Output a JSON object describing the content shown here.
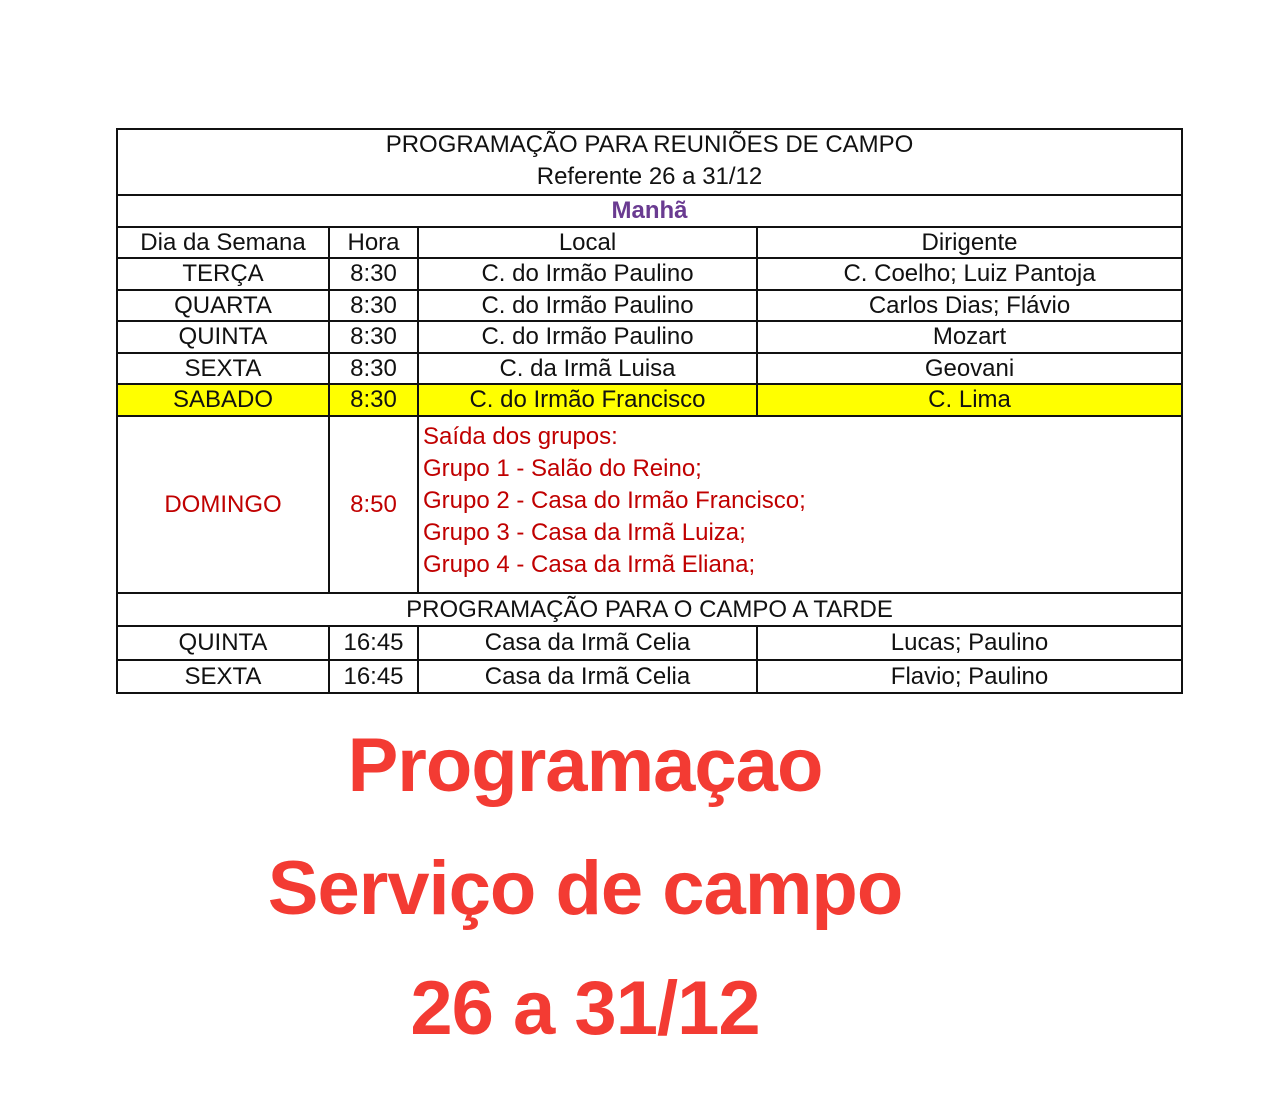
{
  "table": {
    "title_line1": "PROGRAMAÇÃO PARA REUNIÕES DE CAMPO",
    "title_line2": "Referente 26 a 31/12",
    "section_morning": "Manhã",
    "headers": {
      "day": "Dia da Semana",
      "time": "Hora",
      "place": "Local",
      "leader": "Dirigente"
    },
    "morning_rows": [
      {
        "day": "TERÇA",
        "time": "8:30",
        "place": "C. do Irmão Paulino",
        "leader": "C. Coelho; Luiz Pantoja"
      },
      {
        "day": "QUARTA",
        "time": "8:30",
        "place": "C. do Irmão Paulino",
        "leader": "Carlos Dias; Flávio"
      },
      {
        "day": "QUINTA",
        "time": "8:30",
        "place": "C. do Irmão Paulino",
        "leader": "Mozart"
      },
      {
        "day": "SEXTA",
        "time": "8:30",
        "place": "C. da Irmã Luisa",
        "leader": "Geovani"
      },
      {
        "day": "SABADO",
        "time": "8:30",
        "place": "C. do Irmão Francisco",
        "leader": "C. Lima"
      }
    ],
    "sunday": {
      "day": "DOMINGO",
      "time": "8:50",
      "lines": [
        "Saída dos grupos:",
        "Grupo 1 - Salão do Reino;",
        "Grupo 2 - Casa do Irmão Francisco;",
        "Grupo 3 - Casa da Irmã Luiza;",
        "Grupo 4 - Casa da Irmã Eliana;"
      ]
    },
    "section_afternoon": "PROGRAMAÇÃO PARA O CAMPO A TARDE",
    "afternoon_rows": [
      {
        "day": "QUINTA",
        "time": "16:45",
        "place": "Casa da Irmã Celia",
        "leader": "Lucas; Paulino"
      },
      {
        "day": "SEXTA",
        "time": "16:45",
        "place": "Casa da Irmã Celia",
        "leader": "Flavio; Paulino"
      }
    ]
  },
  "caption": {
    "line1": "Programaçao",
    "line2": "Serviço de campo",
    "line3": "26 a 31/12"
  },
  "colors": {
    "caption": "#f33b33",
    "sunday_text": "#c00000",
    "morning_label": "#6a3b91",
    "highlight_row": "#ffff00"
  }
}
